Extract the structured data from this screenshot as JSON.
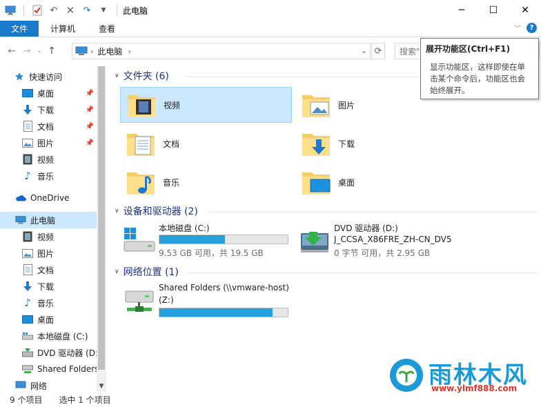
{
  "window": {
    "title": "此电脑"
  },
  "ribbon": {
    "tabs": [
      "文件",
      "计算机",
      "查看"
    ],
    "help": "?"
  },
  "address": {
    "crumb": "此电脑",
    "search_placeholder": "搜索\""
  },
  "tooltip": {
    "title": "展开功能区(Ctrl+F1)",
    "lines": [
      "显示功能区，这样即使在单",
      "击某个命令后，功能区也会",
      "始终展开。"
    ]
  },
  "sidebar": {
    "items": [
      {
        "label": "快速访问",
        "icon": "star-icon"
      },
      {
        "label": "桌面",
        "icon": "desktop-icon",
        "pinned": true
      },
      {
        "label": "下载",
        "icon": "download-icon",
        "pinned": true
      },
      {
        "label": "文档",
        "icon": "document-icon",
        "pinned": true
      },
      {
        "label": "图片",
        "icon": "picture-icon",
        "pinned": true
      },
      {
        "label": "视频",
        "icon": "video-icon"
      },
      {
        "label": "音乐",
        "icon": "music-icon"
      },
      {
        "label": "OneDrive",
        "icon": "cloud-icon"
      },
      {
        "label": "此电脑",
        "icon": "computer-icon",
        "selected": true
      },
      {
        "label": "视频",
        "icon": "video-icon"
      },
      {
        "label": "图片",
        "icon": "picture-icon"
      },
      {
        "label": "文档",
        "icon": "document-icon"
      },
      {
        "label": "下载",
        "icon": "download-icon"
      },
      {
        "label": "音乐",
        "icon": "music-icon"
      },
      {
        "label": "桌面",
        "icon": "desktop-icon"
      },
      {
        "label": "本地磁盘 (C:)",
        "icon": "drive-icon"
      },
      {
        "label": "DVD 驱动器 (D:",
        "icon": "dvd-icon"
      },
      {
        "label": "Shared Folders",
        "icon": "network-drive-icon"
      },
      {
        "label": "网络",
        "icon": "network-icon"
      }
    ]
  },
  "groups": {
    "folders": {
      "header": "文件夹 (6)",
      "items": [
        "视频",
        "图片",
        "文档",
        "下载",
        "音乐",
        "桌面"
      ]
    },
    "devices": {
      "header": "设备和驱动器 (2)"
    },
    "network": {
      "header": "网络位置 (1)"
    }
  },
  "drives": [
    {
      "name": "本地磁盘 (C:)",
      "free": "9.53 GB 可用，共 19.5 GB",
      "used_fraction": 0.51
    },
    {
      "name": "DVD 驱动器 (D:)",
      "name2": "J_CCSA_X86FRE_ZH-CN_DV5",
      "free": "0 字节 可用，共 2.95 GB"
    },
    {
      "name": "Shared Folders (\\\\vmware-host)",
      "name2": "(Z:)",
      "used_fraction": 0.88
    }
  ],
  "status": {
    "count": "9 个项目",
    "selected": "选中 1 个项目"
  },
  "watermark": {
    "title": "雨林木风",
    "url": "www.ylmf888.com"
  },
  "colors": {
    "accent": "#1979ca",
    "selection": "#cce8ff",
    "bar_fill": "#26a0da",
    "group_header": "#1e3287"
  }
}
